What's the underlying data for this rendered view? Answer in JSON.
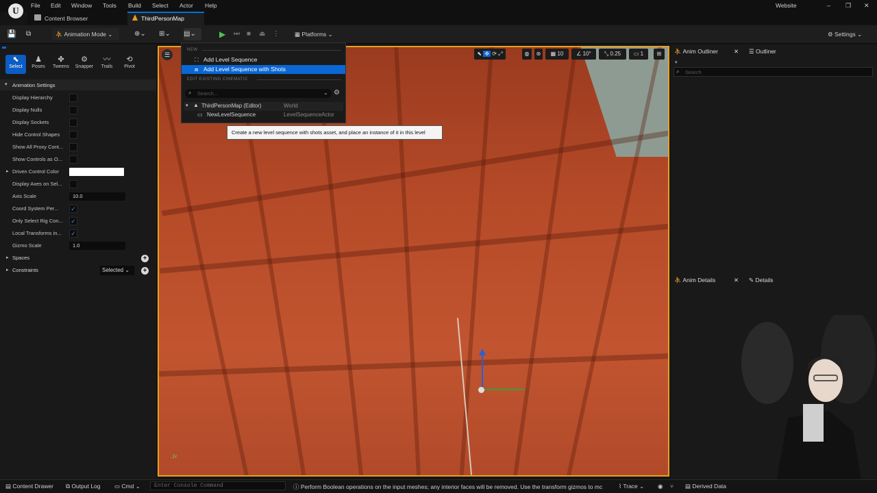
{
  "menubar": {
    "logo": "U",
    "items": [
      "File",
      "Edit",
      "Window",
      "Tools",
      "Build",
      "Select",
      "Actor",
      "Help"
    ],
    "website": "Website",
    "win_min": "–",
    "win_max": "❐",
    "win_close": "✕"
  },
  "tabs": {
    "content_browser": "Content Browser",
    "map": "ThirdPersonMap"
  },
  "toolbar": {
    "mode": "Animation Mode",
    "platforms": "Platforms",
    "settings": "Settings"
  },
  "left_tools": [
    {
      "label": "Select",
      "icon": "⬉"
    },
    {
      "label": "Poses",
      "icon": "♟"
    },
    {
      "label": "Tweens",
      "icon": "✤"
    },
    {
      "label": "Snapper",
      "icon": "⚙"
    },
    {
      "label": "Trails",
      "icon": "〰"
    },
    {
      "label": "Pivot",
      "icon": "⟲"
    }
  ],
  "anim_settings": {
    "header": "Animation Settings",
    "rows": [
      {
        "label": "Display Hierarchy",
        "type": "check",
        "checked": false
      },
      {
        "label": "Display Nulls",
        "type": "check",
        "checked": false
      },
      {
        "label": "Display Sockets",
        "type": "check",
        "checked": false
      },
      {
        "label": "Hide Control Shapes",
        "type": "check",
        "checked": false
      },
      {
        "label": "Show All Proxy Cont...",
        "type": "check",
        "checked": false
      },
      {
        "label": "Show Controls as O...",
        "type": "check",
        "checked": false
      },
      {
        "label": "Driven Control Color",
        "type": "color"
      },
      {
        "label": "Display Axes on Sel...",
        "type": "check",
        "checked": false
      },
      {
        "label": "Axis Scale",
        "type": "field",
        "value": "10.0"
      },
      {
        "label": "Coord System Per...",
        "type": "check",
        "checked": true
      },
      {
        "label": "Only Select Rig Con...",
        "type": "check",
        "checked": true
      },
      {
        "label": "Local Transforms in...",
        "type": "check",
        "checked": true
      },
      {
        "label": "Gizmo Scale",
        "type": "field",
        "value": "1.0"
      }
    ],
    "check_mark": "✓"
  },
  "sections": {
    "spaces": "Spaces",
    "constraints": "Constraints",
    "constraints_dropdown": "Selected"
  },
  "viewport_tools": {
    "grid": "10",
    "angle": "10°",
    "scale": "0.25",
    "cam": "1"
  },
  "dropdown": {
    "new_header": "NEW",
    "add_level_sequence": "Add Level Sequence",
    "add_with_shots": "Add Level Sequence with Shots",
    "edit_header": "EDIT EXISTING CINEMATIC",
    "search_placeholder": "Search...",
    "tree": [
      {
        "name": "ThirdPersonMap (Editor)",
        "type": "World"
      },
      {
        "name": "NewLevelSequence",
        "type": "LevelSequenceActor"
      }
    ]
  },
  "tooltip": "Create a new level sequence with shots asset, and place an instance of it in this level",
  "right_panels": {
    "anim_outliner": "Anim Outliner",
    "outliner": "Outliner",
    "search_placeholder": "Search",
    "anim_details": "Anim Details",
    "details": "Details",
    "close": "✕"
  },
  "statusbar": {
    "content_drawer": "Content Drawer",
    "output_log": "Output Log",
    "cmd": "Cmd",
    "console_placeholder": "Enter Console Command",
    "message": "Perform Boolean operations on the input meshes; any interior faces will be removed. Use the transform gizmos to mc",
    "trace": "Trace",
    "derived_data": "Derived Data"
  },
  "colors": {
    "accent": "#0a67d4",
    "viewport_border": "#e8a020",
    "container": "#b54a28"
  }
}
